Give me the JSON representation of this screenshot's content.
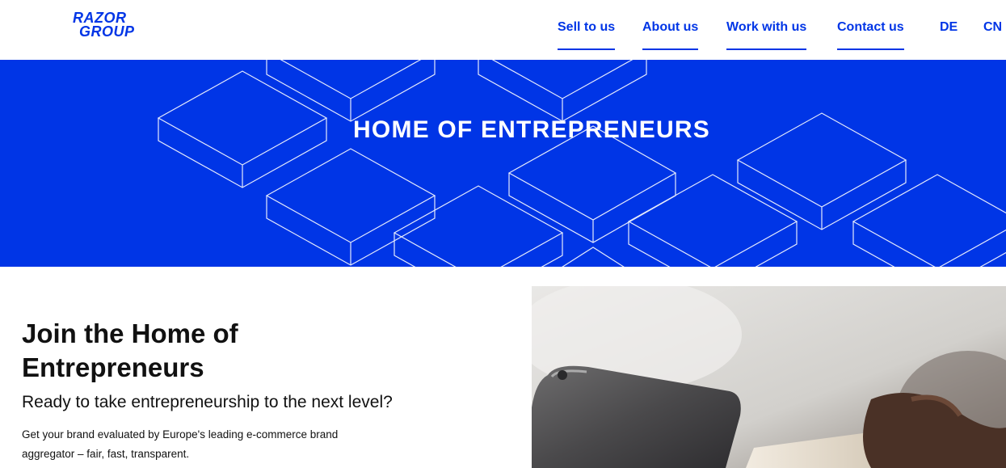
{
  "header": {
    "logo_line1": "RAZOR",
    "logo_line2": "GROUP",
    "nav": [
      {
        "label": "Sell to us"
      },
      {
        "label": "About us"
      },
      {
        "label": "Work with us"
      },
      {
        "label": "Contact us"
      },
      {
        "label": "DE"
      },
      {
        "label": "CN"
      }
    ]
  },
  "hero": {
    "title": "HOME OF ENTREPRENEURS"
  },
  "main": {
    "title": "Join the Home of Entrepreneurs",
    "subtitle": "Ready to take entrepreneurship to the next level?",
    "body": "Get your brand evaluated by Europe's leading e-commerce brand aggregator – fair, fast, transparent."
  },
  "colors": {
    "brand_blue": "#0035e6",
    "white": "#ffffff",
    "text": "#111111"
  }
}
